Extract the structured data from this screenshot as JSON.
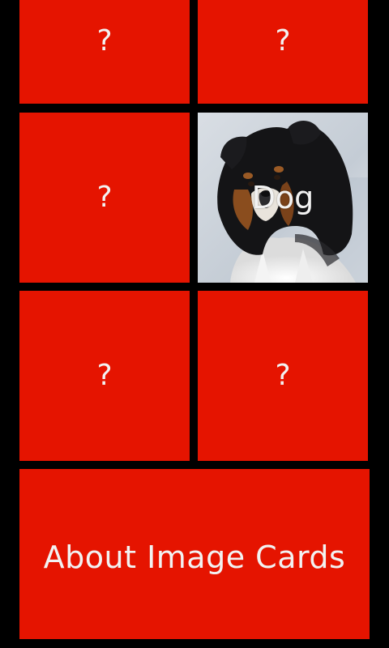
{
  "colors": {
    "background": "#000000",
    "tile": "#E51400",
    "text": "#F2F2F2"
  },
  "cards": [
    {
      "label": "?",
      "revealed": false
    },
    {
      "label": "?",
      "revealed": false
    },
    {
      "label": "?",
      "revealed": false
    },
    {
      "label": "Dog",
      "revealed": true,
      "image": "dog-photo"
    },
    {
      "label": "?",
      "revealed": false
    },
    {
      "label": "?",
      "revealed": false
    }
  ],
  "about": {
    "label": "About Image Cards"
  }
}
